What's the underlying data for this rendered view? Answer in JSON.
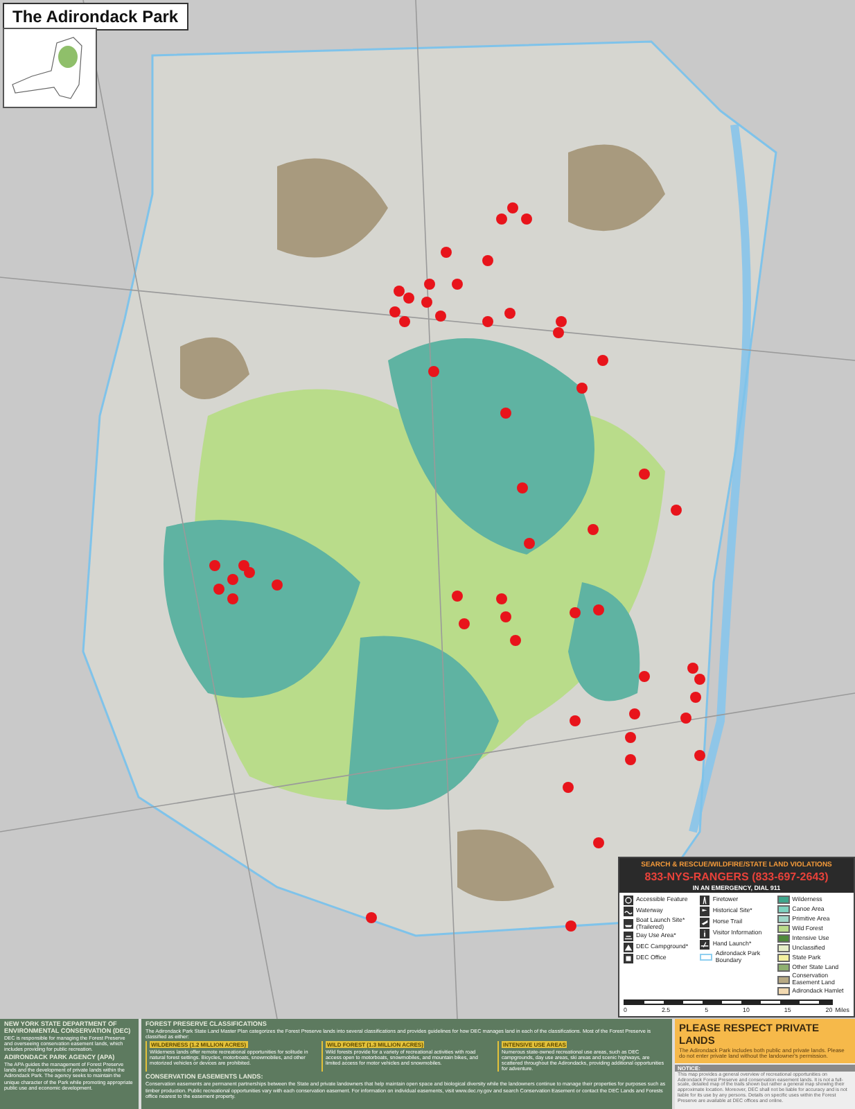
{
  "title": "The Adirondack Park",
  "legend": {
    "alert_title": "SEARCH & RESCUE/WILDFIRE/STATE LAND VIOLATIONS",
    "phone": "833-NYS-RANGERS (833-697-2643)",
    "emergency": "IN AN EMERGENCY, DIAL 911",
    "symbols": [
      {
        "kind": "access",
        "label": "Accessible Feature"
      },
      {
        "kind": "water",
        "label": "Waterway"
      },
      {
        "kind": "boat",
        "label": "Boat Launch Site* (Trailered)"
      },
      {
        "kind": "dayuse",
        "label": "Day Use Area*"
      },
      {
        "kind": "camp",
        "label": "DEC Campground*"
      },
      {
        "kind": "office",
        "label": "DEC Office"
      },
      {
        "kind": "tower",
        "label": "Firetower"
      },
      {
        "kind": "history",
        "label": "Historical Site*"
      },
      {
        "kind": "horse",
        "label": "Horse Trail"
      },
      {
        "kind": "info",
        "label": "Visitor Information"
      },
      {
        "kind": "hand",
        "label": "Hand Launch*"
      },
      {
        "kind": "boundary",
        "label": "Adirondack Park Boundary"
      }
    ],
    "land_classes": [
      {
        "label": "Wilderness",
        "color": "#3fa68c"
      },
      {
        "label": "Canoe Area",
        "color": "#7fd3c0"
      },
      {
        "label": "Primitive Area",
        "color": "#9fd8c8"
      },
      {
        "label": "Wild Forest",
        "color": "#b9dc8a"
      },
      {
        "label": "Intensive Use",
        "color": "#4f8a3a"
      },
      {
        "label": "Unclassified",
        "color": "#e6efc8"
      },
      {
        "label": "State Park",
        "color": "#f3f0a0"
      },
      {
        "label": "Other State Land",
        "color": "#8fb070"
      },
      {
        "label": "Conservation Easement Land",
        "color": "#b7a983"
      },
      {
        "label": "Adirondack Hamlet",
        "color": "#f2d9b0"
      }
    ],
    "scale_labels": [
      "0",
      "2.5",
      "5",
      "10",
      "15",
      "20"
    ],
    "scale_unit": "Miles"
  },
  "info": {
    "agencies": [
      {
        "heading": "NEW YORK STATE DEPARTMENT OF ENVIRONMENTAL CONSERVATION (DEC)",
        "text": "DEC is responsible for managing the Forest Preserve and overseeing conservation easement lands, which includes providing for public recreation."
      },
      {
        "heading": "ADIRONDACK PARK AGENCY (APA)",
        "text": "The APA guides the management of Forest Preserve lands and the development of private lands within the Adirondack Park. The agency seeks to maintain the unique character of the Park while promoting appropriate public use and economic development."
      }
    ],
    "classifications": {
      "heading": "FOREST PRESERVE CLASSIFICATIONS",
      "intro": "The Adirondack Park State Land Master Plan categorizes the Forest Preserve lands into several classifications and provides guidelines for how DEC manages land in each of the classifications. Most of the Forest Preserve is classified as either:",
      "items": [
        {
          "heading": "WILDERNESS (1.2 MILLION ACRES)",
          "text": "Wilderness lands offer remote recreational opportunities for solitude in natural forest settings. Bicycles, motorboats, snowmobiles, and other motorized vehicles or devices are prohibited."
        },
        {
          "heading": "WILD FOREST (1.3 MILLION ACRES)",
          "text": "Wild forests provide for a variety of recreational activities with road access open to motorboats, snowmobiles, and mountain bikes, and limited access for motor vehicles and snowmobiles."
        },
        {
          "heading": "INTENSIVE USE AREAS",
          "text": "Numerous state-owned recreational use areas, such as DEC campgrounds, day use areas, ski areas and scenic highways, are scattered throughout the Adirondacks, providing additional opportunities for adventure."
        }
      ],
      "easements_heading": "CONSERVATION EASEMENTS LANDS:",
      "easements_text": "Conservation easements are permanent partnerships between the State and private landowners that help maintain open space and biological diversity while the landowners continue to manage their properties for purposes such as timber production. Public recreational opportunities vary with each conservation easement. For information on individual easements, visit www.dec.ny.gov and search Conservation Easement or contact the DEC Lands and Forests office nearest to the easement property."
    },
    "private": {
      "heading": "PLEASE RESPECT PRIVATE LANDS",
      "text": "The Adirondack Park includes both public and private lands. Please do not enter private land without the landowner's permission.",
      "notice_heading": "NOTICE:",
      "notice_text": "This map provides a general overview of recreational opportunities on Adirondack Forest Preserve and conservation easement lands. It is not a full-scale, detailed map of the trails shown but rather a general map showing their approximate location. Moreover, DEC shall not be liable for accuracy and is not liable for its use by any persons. Details on specific uses within the Forest Preserve are available at DEC offices and online."
    }
  }
}
